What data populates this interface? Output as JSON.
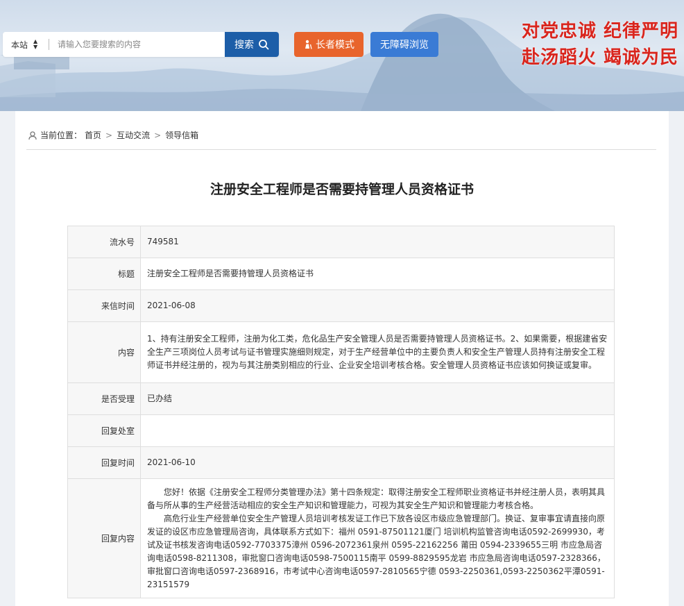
{
  "header": {
    "scope_label": "本站",
    "search_placeholder": "请输入您要搜索的内容",
    "search_button": "搜索",
    "elder_mode": "长者模式",
    "accessible_browse": "无障碍浏览",
    "slogan_line1": "对党忠诚  纪律严明",
    "slogan_line2": "赴汤蹈火  竭诚为民",
    "colors": {
      "search_button": "#1d5ea8",
      "elder_button": "#e8642c",
      "access_button": "#3a7bd5",
      "slogan": "#d9251d"
    }
  },
  "breadcrumb": {
    "prefix": "当前位置：",
    "items": [
      "首页",
      "互动交流",
      "领导信箱"
    ],
    "separator": ">"
  },
  "page_title": "注册安全工程师是否需要持管理人员资格证书",
  "table": {
    "serial_label": "流水号",
    "serial_value": "749581",
    "title_label": "标题",
    "title_value": "注册安全工程师是否需要持管理人员资格证书",
    "date_label": "来信时间",
    "date_value": "2021-06-08",
    "content_label": "内容",
    "content_value": "1、持有注册安全工程师，注册为化工类，危化品生产安全管理人员是否需要持管理人员资格证书。2、如果需要，根据建省安全生产三项岗位人员考试与证书管理实施细则规定，对于生产经营单位中的主要负责人和安全生产管理人员持有注册安全工程师证书并经注册的，视为与其注册类别相应的行业、企业安全培训考核合格。安全管理人员资格证书应该如何换证或复审。",
    "accepted_label": "是否受理",
    "accepted_value": "已办结",
    "office_label": "回复处室",
    "office_value": "",
    "reply_date_label": "回复时间",
    "reply_date_value": "2021-06-10",
    "reply_label": "回复内容",
    "reply_p1": "您好！依据《注册安全工程师分类管理办法》第十四条规定：取得注册安全工程师职业资格证书并经注册人员，表明其具备与所从事的生产经营活动相应的安全生产知识和管理能力，可视为其安全生产知识和管理能力考核合格。",
    "reply_p2": "高危行业生产经营单位安全生产管理人员培训考核发证工作已下放各设区市级应急管理部门。换证、复审事宜请直接向原发证的设区市应急管理局咨询，具体联系方式如下：福州 0591-87501121厦门 培训机构监管咨询电话0592-2699930，考试及证书核发咨询电话0592-7703375漳州 0596-2072361泉州 0595-22162256    莆田 0594-2339655三明 市应急局咨询电话0598-8211308，审批窗口咨询电话0598-7500115南平 0599-8829595龙岩 市应急局咨询电话0597-2328366，审批窗口咨询电话0597-2368916，市考试中心咨询电话0597-2810565宁德 0593-2250361,0593-2250362平潭0591-23151579"
  }
}
